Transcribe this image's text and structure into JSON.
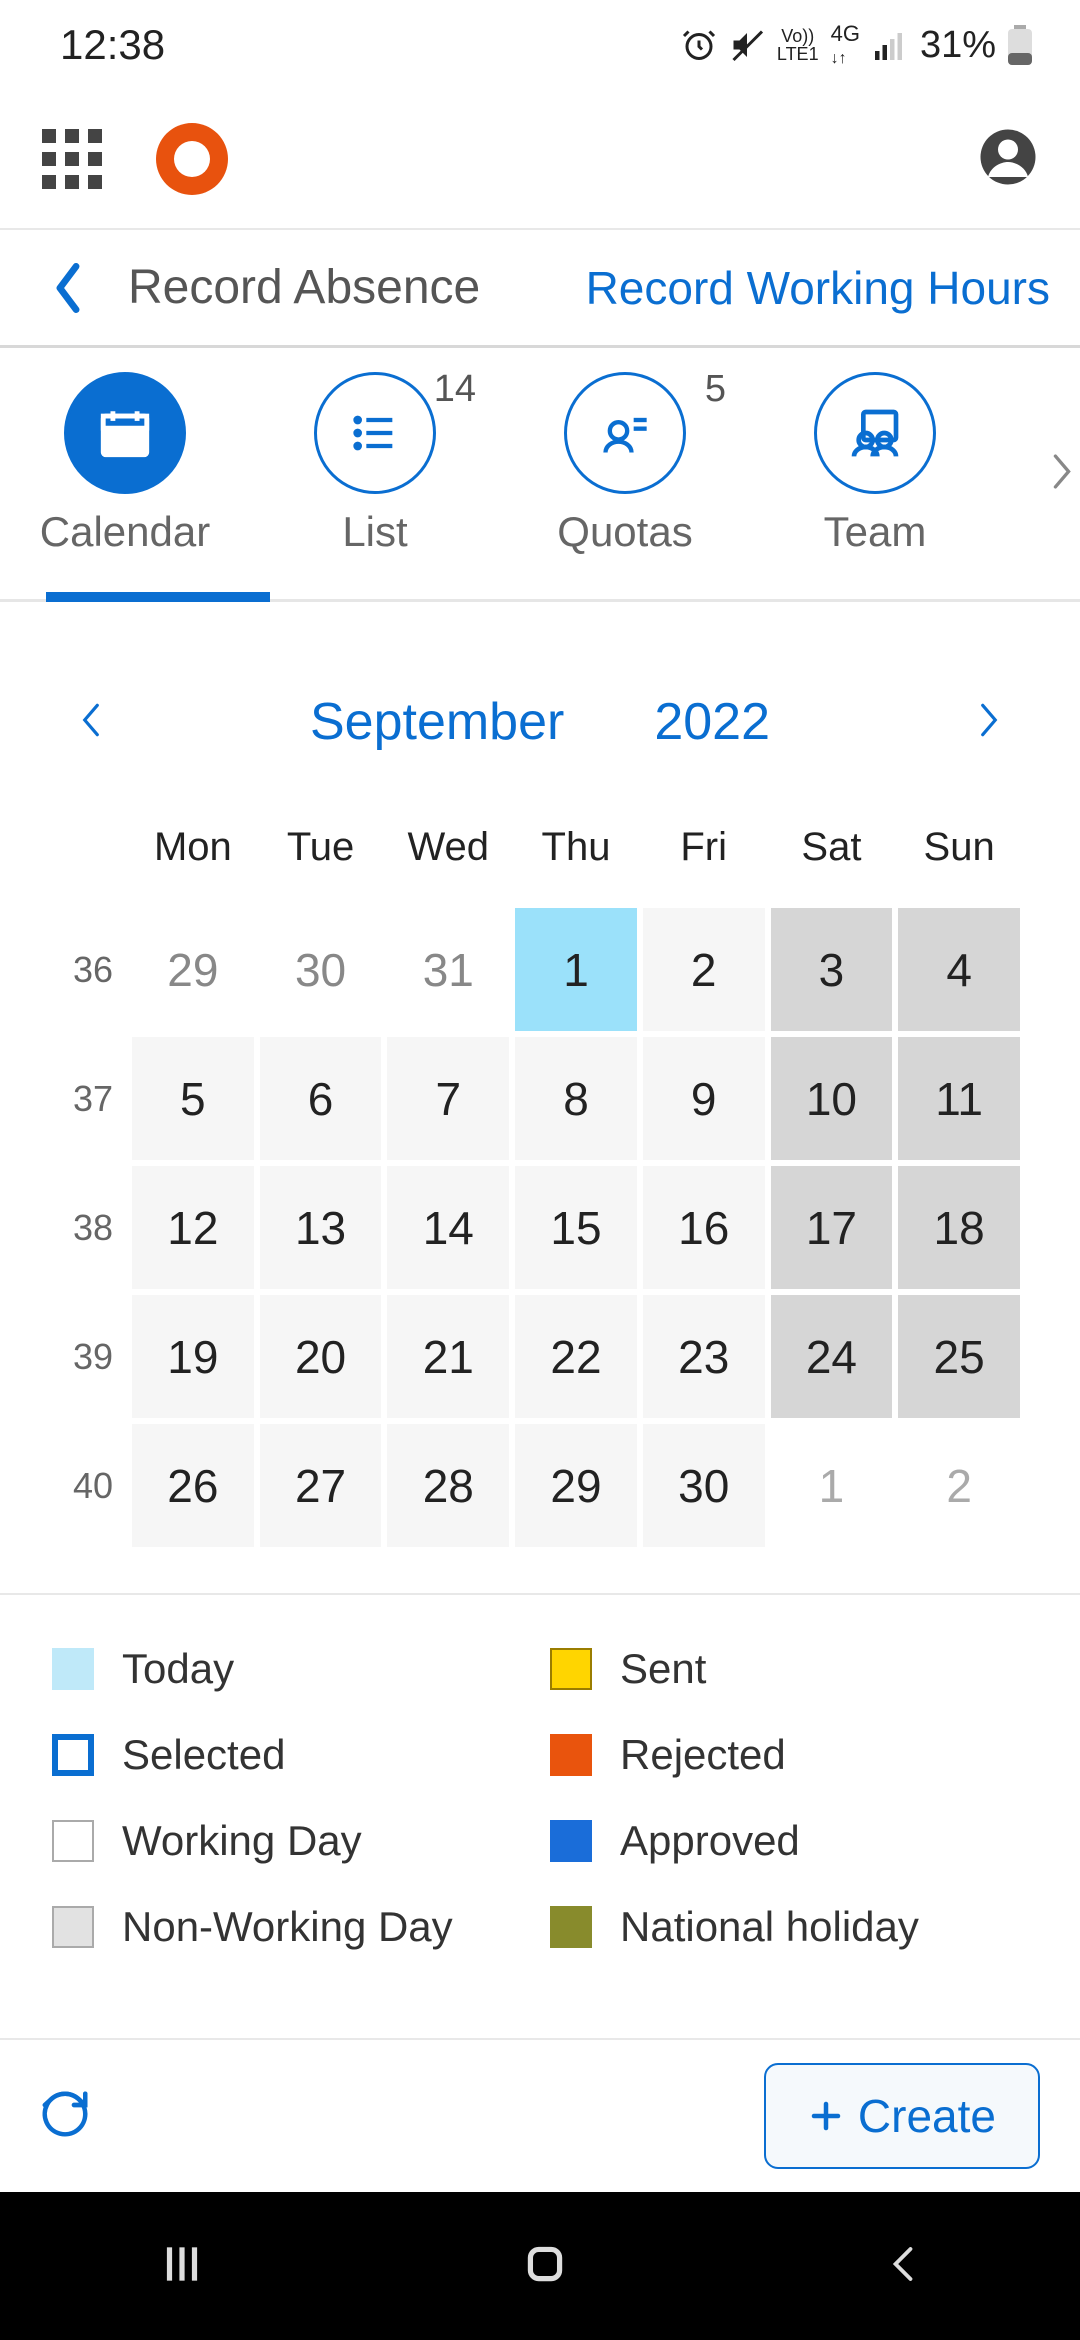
{
  "status": {
    "time": "12:38",
    "battery_text": "31%"
  },
  "header": {
    "title": "Record Absence",
    "action_link": "Record Working Hours"
  },
  "tabs": [
    {
      "label": "Calendar",
      "badge": "",
      "active": true
    },
    {
      "label": "List",
      "badge": "14",
      "active": false
    },
    {
      "label": "Quotas",
      "badge": "5",
      "active": false
    },
    {
      "label": "Team",
      "badge": "",
      "active": false
    }
  ],
  "month_nav": {
    "month": "September",
    "year": "2022"
  },
  "weekdays": [
    "Mon",
    "Tue",
    "Wed",
    "Thu",
    "Fri",
    "Sat",
    "Sun"
  ],
  "weeks": [
    {
      "num": "36",
      "days": [
        {
          "d": "29",
          "cls": "other-month"
        },
        {
          "d": "30",
          "cls": "other-month"
        },
        {
          "d": "31",
          "cls": "other-month"
        },
        {
          "d": "1",
          "cls": "today"
        },
        {
          "d": "2",
          "cls": ""
        },
        {
          "d": "3",
          "cls": "weekend"
        },
        {
          "d": "4",
          "cls": "weekend"
        }
      ]
    },
    {
      "num": "37",
      "days": [
        {
          "d": "5",
          "cls": ""
        },
        {
          "d": "6",
          "cls": ""
        },
        {
          "d": "7",
          "cls": ""
        },
        {
          "d": "8",
          "cls": ""
        },
        {
          "d": "9",
          "cls": ""
        },
        {
          "d": "10",
          "cls": "weekend"
        },
        {
          "d": "11",
          "cls": "weekend"
        }
      ]
    },
    {
      "num": "38",
      "days": [
        {
          "d": "12",
          "cls": ""
        },
        {
          "d": "13",
          "cls": ""
        },
        {
          "d": "14",
          "cls": ""
        },
        {
          "d": "15",
          "cls": ""
        },
        {
          "d": "16",
          "cls": ""
        },
        {
          "d": "17",
          "cls": "weekend"
        },
        {
          "d": "18",
          "cls": "weekend"
        }
      ]
    },
    {
      "num": "39",
      "days": [
        {
          "d": "19",
          "cls": ""
        },
        {
          "d": "20",
          "cls": ""
        },
        {
          "d": "21",
          "cls": ""
        },
        {
          "d": "22",
          "cls": ""
        },
        {
          "d": "23",
          "cls": ""
        },
        {
          "d": "24",
          "cls": "weekend"
        },
        {
          "d": "25",
          "cls": "weekend"
        }
      ]
    },
    {
      "num": "40",
      "days": [
        {
          "d": "26",
          "cls": ""
        },
        {
          "d": "27",
          "cls": ""
        },
        {
          "d": "28",
          "cls": ""
        },
        {
          "d": "29",
          "cls": ""
        },
        {
          "d": "30",
          "cls": ""
        },
        {
          "d": "1",
          "cls": "next-month"
        },
        {
          "d": "2",
          "cls": "next-month"
        }
      ]
    }
  ],
  "legend": {
    "today": "Today",
    "selected": "Selected",
    "working": "Working Day",
    "nonworking": "Non-Working Day",
    "sent": "Sent",
    "rejected": "Rejected",
    "approved": "Approved",
    "holiday": "National holiday"
  },
  "footer": {
    "create_label": "Create"
  }
}
